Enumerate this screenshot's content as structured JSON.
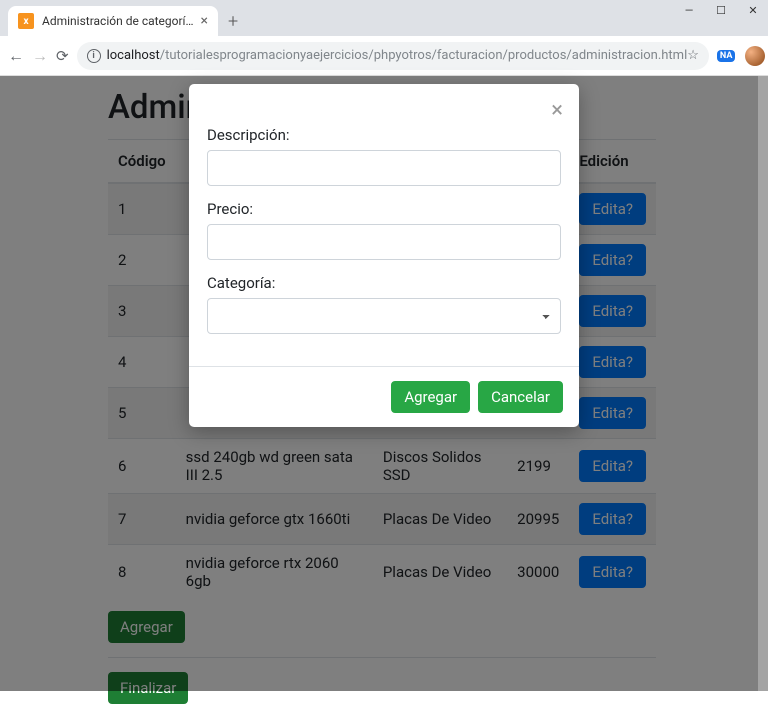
{
  "browser": {
    "tab_title": "Administración de categorías",
    "url_host": "localhost",
    "url_path": "/tutorialesprogramacionyaejercicios/phpyotros/facturacion/productos/administracion.html",
    "ext_badge": "NA"
  },
  "page": {
    "title": "Administracion de Productos",
    "columns": [
      "Código",
      "",
      "",
      "",
      "Edición"
    ],
    "rows": [
      {
        "codigo": "1",
        "desc": "",
        "cat": "",
        "precio": "",
        "edit": "Edita?"
      },
      {
        "codigo": "2",
        "desc": "",
        "cat": "",
        "precio": "",
        "edit": "Edita?"
      },
      {
        "codigo": "3",
        "desc": "",
        "cat": "",
        "precio": "",
        "edit": "Edita?"
      },
      {
        "codigo": "4",
        "desc": "",
        "cat": "",
        "precio": "",
        "edit": "Edita?"
      },
      {
        "codigo": "5",
        "desc": "",
        "cat": "",
        "precio": "",
        "edit": "Edita?"
      },
      {
        "codigo": "6",
        "desc": "ssd 240gb wd green sata III 2.5",
        "cat": "Discos Solidos SSD",
        "precio": "2199",
        "edit": "Edita?"
      },
      {
        "codigo": "7",
        "desc": "nvidia geforce gtx 1660ti",
        "cat": "Placas De Video",
        "precio": "20995",
        "edit": "Edita?"
      },
      {
        "codigo": "8",
        "desc": "nvidia geforce rtx 2060 6gb",
        "cat": "Placas De Video",
        "precio": "30000",
        "edit": "Edita?"
      }
    ],
    "btn_agregar": "Agregar",
    "btn_finalizar": "Finalizar"
  },
  "modal": {
    "label_descripcion": "Descripción:",
    "label_precio": "Precio:",
    "label_categoria": "Categoría:",
    "btn_agregar": "Agregar",
    "btn_cancelar": "Cancelar"
  }
}
